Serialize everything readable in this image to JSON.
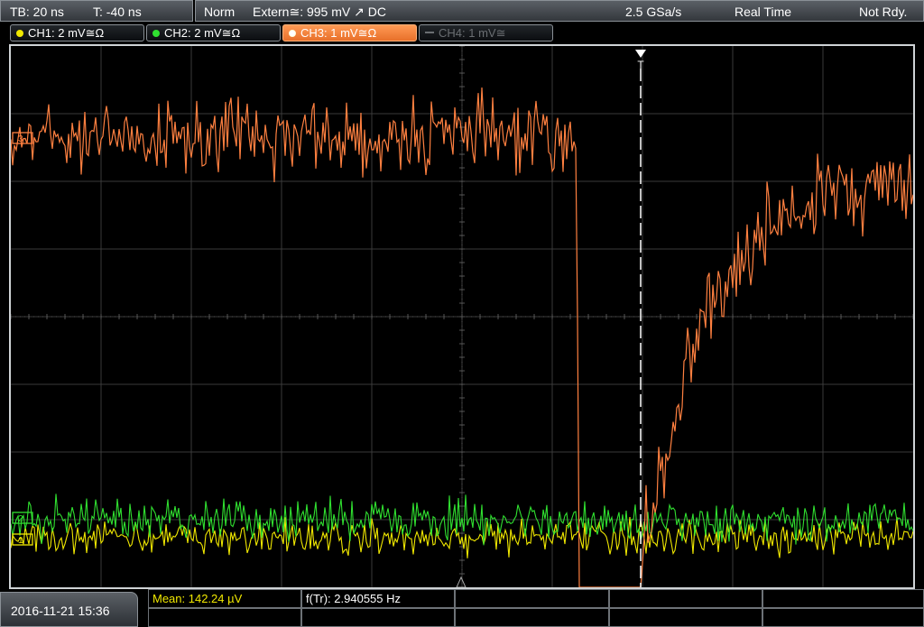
{
  "topbar": {
    "timebase": "TB: 20 ns",
    "trigger_time": "T: -40 ns",
    "mode": "Norm",
    "trigger_source": "Extern≅: 995 mV ↗ DC",
    "sample_rate": "2.5 GSa/s",
    "acq_mode": "Real Time",
    "status": "Not Rdy."
  },
  "channels": [
    {
      "label": "CH1: 2 mV≅Ω",
      "color": "#f0e800",
      "active": false
    },
    {
      "label": "CH2: 2 mV≅Ω",
      "color": "#30e030",
      "active": false
    },
    {
      "label": "CH3: 1 mV≅Ω",
      "color": "#ff8c40",
      "active": true
    },
    {
      "label": "CH4: 1 mV≅",
      "color": "#606468",
      "active": false
    }
  ],
  "markers": {
    "ch3": "3",
    "ch2": "2",
    "ch1": "1",
    "trigger": "T"
  },
  "footer": {
    "datetime": "2016-11-21 15:36",
    "mean": "Mean: 142.24 µV",
    "freq": "f(Tr): 2.940555 Hz"
  },
  "colors": {
    "ch1": "#f0e800",
    "ch2": "#30e030",
    "ch3": "#ff8040",
    "grid": "#3a3a3a"
  }
}
